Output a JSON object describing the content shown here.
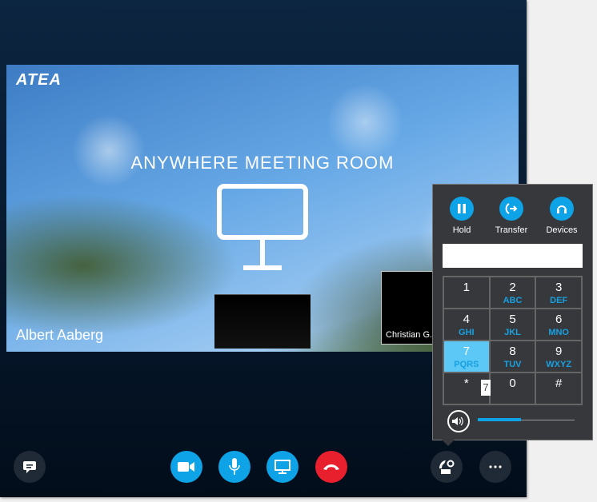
{
  "stage": {
    "logo": "ATEA",
    "room_title": "ANYWHERE MEETING ROOM",
    "participant_name": "Albert Aaberg",
    "tile_name": "Christian G..."
  },
  "controls": [
    {
      "name": "im",
      "icon": "chat-icon"
    },
    {
      "name": "video",
      "icon": "camera-icon"
    },
    {
      "name": "mic",
      "icon": "microphone-icon"
    },
    {
      "name": "share",
      "icon": "monitor-icon"
    },
    {
      "name": "hangup",
      "icon": "hang-up-icon"
    },
    {
      "name": "call-controls",
      "icon": "phone-settings-icon"
    },
    {
      "name": "more",
      "icon": "more-icon"
    }
  ],
  "dialpad": {
    "actions": [
      {
        "label": "Hold",
        "icon": "pause-icon"
      },
      {
        "label": "Transfer",
        "icon": "transfer-icon"
      },
      {
        "label": "Devices",
        "icon": "headset-icon"
      }
    ],
    "number_value": "",
    "keys": [
      {
        "d": "1",
        "l": ""
      },
      {
        "d": "2",
        "l": "ABC"
      },
      {
        "d": "3",
        "l": "DEF"
      },
      {
        "d": "4",
        "l": "GHI"
      },
      {
        "d": "5",
        "l": "JKL"
      },
      {
        "d": "6",
        "l": "MNO"
      },
      {
        "d": "7",
        "l": "PQRS"
      },
      {
        "d": "8",
        "l": "TUV"
      },
      {
        "d": "9",
        "l": "WXYZ"
      },
      {
        "d": "*",
        "l": ""
      },
      {
        "d": "0",
        "l": ""
      },
      {
        "d": "#",
        "l": ""
      }
    ],
    "pressed_key": "7",
    "tooltip": "7",
    "volume_percent": 45
  },
  "colors": {
    "accent": "#0ea2e6",
    "hangup": "#e81f2c",
    "pressed": "#5bc8f5"
  }
}
